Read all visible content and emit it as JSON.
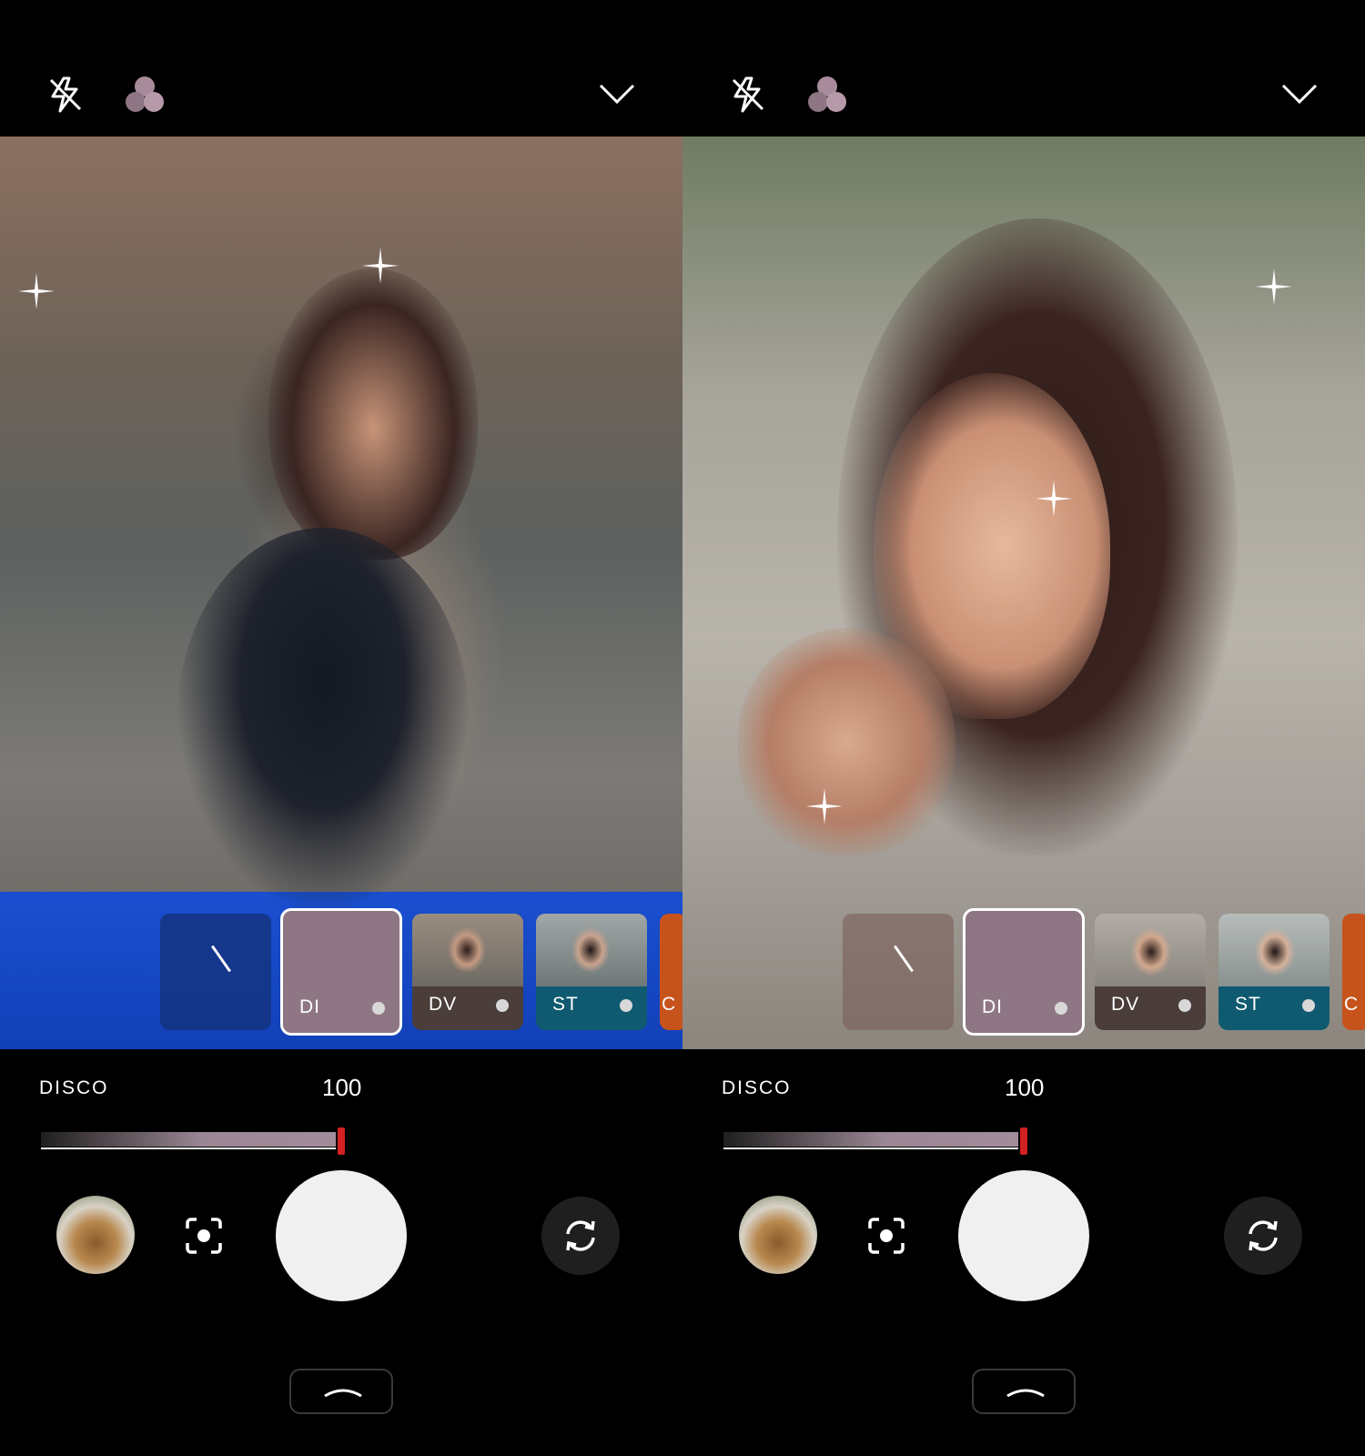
{
  "panels": [
    {
      "id": "left",
      "filter_name": "DISCO",
      "filter_value": "100",
      "slider_level_percent": 100,
      "chips": [
        {
          "label": "",
          "kind": "none"
        },
        {
          "label": "DI",
          "kind": "selected"
        },
        {
          "label": "DV",
          "kind": "preset"
        },
        {
          "label": "ST",
          "kind": "preset"
        },
        {
          "label": "C",
          "kind": "preset"
        }
      ]
    },
    {
      "id": "right",
      "filter_name": "DISCO",
      "filter_value": "100",
      "slider_level_percent": 100,
      "chips": [
        {
          "label": "",
          "kind": "none"
        },
        {
          "label": "DI",
          "kind": "selected"
        },
        {
          "label": "DV",
          "kind": "preset"
        },
        {
          "label": "ST",
          "kind": "preset"
        },
        {
          "label": "C",
          "kind": "preset"
        }
      ]
    }
  ],
  "icons": {
    "flash": "flash-off-icon",
    "filters": "filters-icon",
    "collapse": "chevron-down-icon",
    "focus": "focus-icon",
    "flip": "flip-camera-icon",
    "drawer": "chevron-up-icon"
  },
  "colors": {
    "accent_filter": "#8e7684",
    "slider_thumb": "#d32020",
    "shutter": "#f0f0f0",
    "chip_dv": "#4a3d3a",
    "chip_st": "#0f5a70",
    "chip_c": "#c7531c"
  }
}
